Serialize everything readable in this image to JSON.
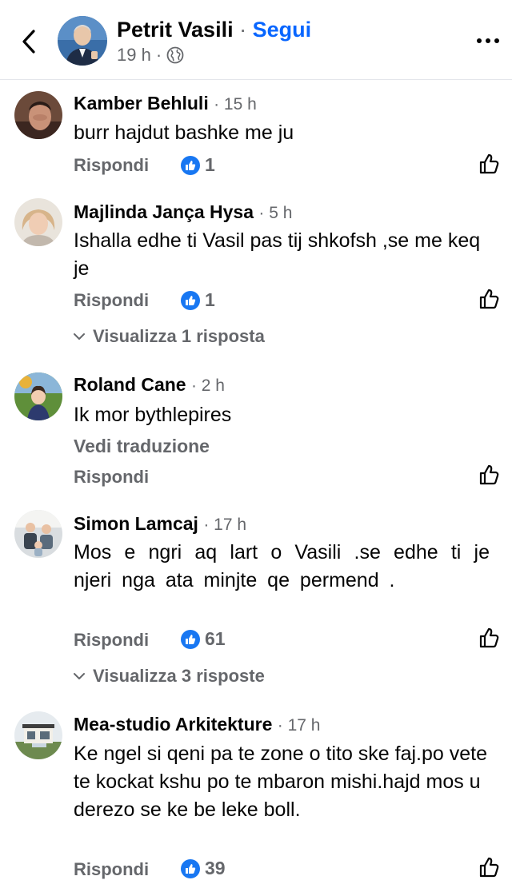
{
  "post_header": {
    "author": "Petrit Vasili",
    "separator": "·",
    "follow_label": "Segui",
    "time": "19 h",
    "meta_separator": "·",
    "audience_icon": "globe-icon"
  },
  "labels": {
    "reply": "Rispondi",
    "see_translation": "Vedi traduzione"
  },
  "comments": [
    {
      "author": "Kamber Behluli",
      "time": "· 15 h",
      "text": "burr hajdut bashke me ju",
      "likes": "1"
    },
    {
      "author": "Majlinda Jança Hysa",
      "time": "· 5 h",
      "text": "Ishalla edhe ti Vasil pas tij shkofsh ,se me keq je",
      "likes": "1",
      "view_replies": "Visualizza 1 risposta"
    },
    {
      "author": "Roland Cane",
      "time": "· 2 h",
      "text": "Ik mor bythlepires"
    },
    {
      "author": "Simon Lamcaj",
      "time": "· 17 h",
      "text": "Mos e ngri aq lart o Vasili .se edhe ti je njeri nga ata minjte qe permend .",
      "likes": "61",
      "view_replies": "Visualizza 3 risposte"
    },
    {
      "author": "Mea-studio Arkitekture",
      "time": "· 17 h",
      "text": "Ke ngel si qeni pa te zone o tito ske faj.po vete te kockat kshu po te mbaron mishi.hajd mos u derezo se ke be leke boll.",
      "likes": "39"
    }
  ],
  "colors": {
    "link_blue": "#0866ff",
    "like_blue": "#1877f2",
    "secondary_text": "#65676b"
  }
}
